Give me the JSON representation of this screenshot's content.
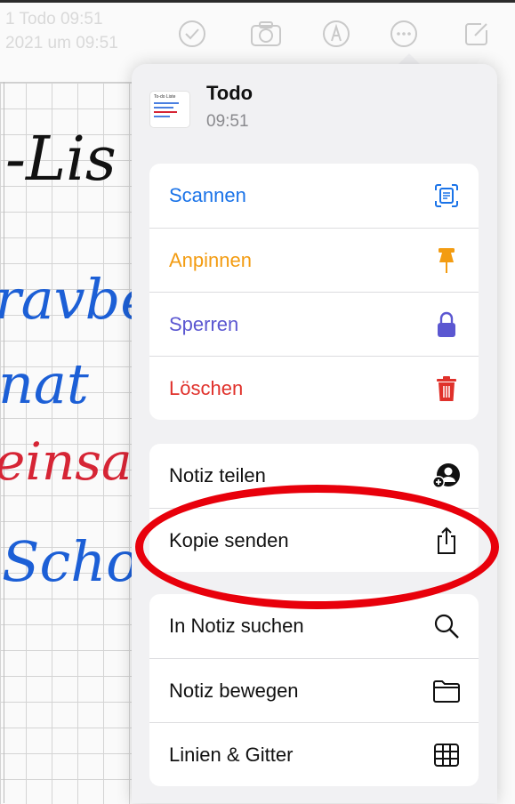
{
  "toolbar": {
    "note_title_faded": "1 Todo 09:51",
    "note_date_faded": "2021 um 09:51",
    "icons": [
      "checkmark-circle-icon",
      "camera-icon",
      "markup-pen-icon",
      "more-ellipsis-icon",
      "compose-icon"
    ]
  },
  "handwriting": [
    "-Lis",
    "ravbe",
    "nat",
    "einsa",
    "Schol"
  ],
  "menu": {
    "note": {
      "title": "Todo",
      "time": "09:51",
      "thumb_title": "To-do Liste"
    },
    "groups": [
      [
        {
          "label": "Scannen",
          "color": "#1a73e8",
          "icon": "scan-document-icon"
        },
        {
          "label": "Anpinnen",
          "color": "#f39c12",
          "icon": "pin-icon"
        },
        {
          "label": "Sperren",
          "color": "#5b57d1",
          "icon": "lock-icon"
        },
        {
          "label": "Löschen",
          "color": "#e0312b",
          "icon": "trash-icon"
        }
      ],
      [
        {
          "label": "Notiz teilen",
          "color": "#111111",
          "icon": "share-note-person-icon"
        },
        {
          "label": "Kopie senden",
          "color": "#111111",
          "icon": "share-upload-icon"
        }
      ],
      [
        {
          "label": "In Notiz suchen",
          "color": "#111111",
          "icon": "search-icon"
        },
        {
          "label": "Notiz bewegen",
          "color": "#111111",
          "icon": "folder-icon"
        },
        {
          "label": "Linien & Gitter",
          "color": "#111111",
          "icon": "grid-icon"
        }
      ]
    ]
  },
  "colors": {
    "accent_red": "#e8000b",
    "blue": "#1a73e8",
    "orange": "#f39c12",
    "purple": "#5b57d1",
    "red": "#e0312b"
  }
}
